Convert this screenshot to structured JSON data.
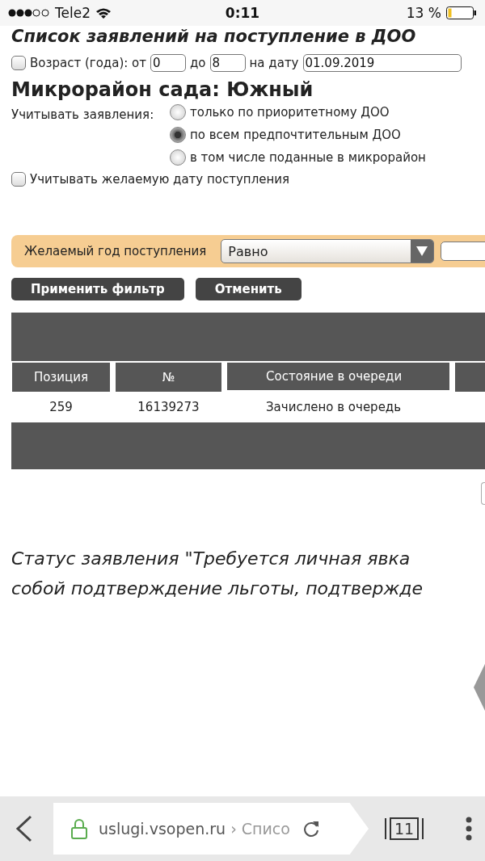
{
  "status_bar": {
    "carrier": "Tele2",
    "time": "0:11",
    "battery": "13 %"
  },
  "page_title": "Список заявлений на поступление в ДОО",
  "age_filter": {
    "checked": false,
    "label": "Возраст (года): от",
    "from": "0",
    "to_label": "до",
    "to": "8",
    "date_label": "на дату",
    "date": "01.09.2019"
  },
  "district_heading": "Микрорайон сада: Южный",
  "consider": {
    "label": "Учитывать заявления:",
    "options": [
      {
        "label": "только по приоритетному ДОО",
        "selected": false
      },
      {
        "label": "по всем предпочтительным ДОО",
        "selected": true
      },
      {
        "label": "в том числе поданные в микрорайон",
        "selected": false
      }
    ]
  },
  "desired_date": {
    "checked": false,
    "label": "Учитывать желаемую дату поступления"
  },
  "year_filter": {
    "label": "Желаемый год поступления",
    "operator": "Равно"
  },
  "buttons": [
    "Применить фильтр",
    "Отменить"
  ],
  "table": {
    "columns": [
      "Позиция",
      "№",
      "Состояние в очереди"
    ],
    "rows": [
      [
        "259",
        "16139273",
        "Зачислено в очередь"
      ]
    ]
  },
  "note_lines": [
    "Статус заявления \"Требуется личная явка",
    "собой подтверждение льготы, подтвержде"
  ],
  "browser": {
    "domain": "uslugi.vsopen.ru",
    "path": "› Списо",
    "tab_count": "11"
  }
}
